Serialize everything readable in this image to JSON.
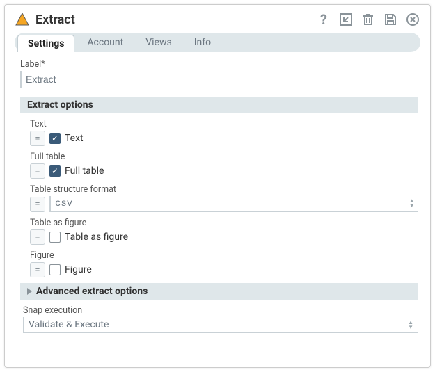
{
  "header": {
    "title": "Extract"
  },
  "tabs": [
    {
      "label": "Settings",
      "active": true
    },
    {
      "label": "Account",
      "active": false
    },
    {
      "label": "Views",
      "active": false
    },
    {
      "label": "Info",
      "active": false
    }
  ],
  "label_field": {
    "label": "Label*",
    "value": "Extract"
  },
  "extract_options": {
    "heading": "Extract options",
    "text": {
      "label": "Text",
      "checkbox_label": "Text",
      "checked": true
    },
    "full_table": {
      "label": "Full table",
      "checkbox_label": "Full table",
      "checked": true
    },
    "table_structure_format": {
      "label": "Table structure format",
      "value": "csv"
    },
    "table_as_figure": {
      "label": "Table as figure",
      "checkbox_label": "Table as figure",
      "checked": false
    },
    "figure": {
      "label": "Figure",
      "checkbox_label": "Figure",
      "checked": false
    }
  },
  "advanced": {
    "heading": "Advanced extract options"
  },
  "snap_execution": {
    "label": "Snap execution",
    "value": "Validate & Execute"
  }
}
